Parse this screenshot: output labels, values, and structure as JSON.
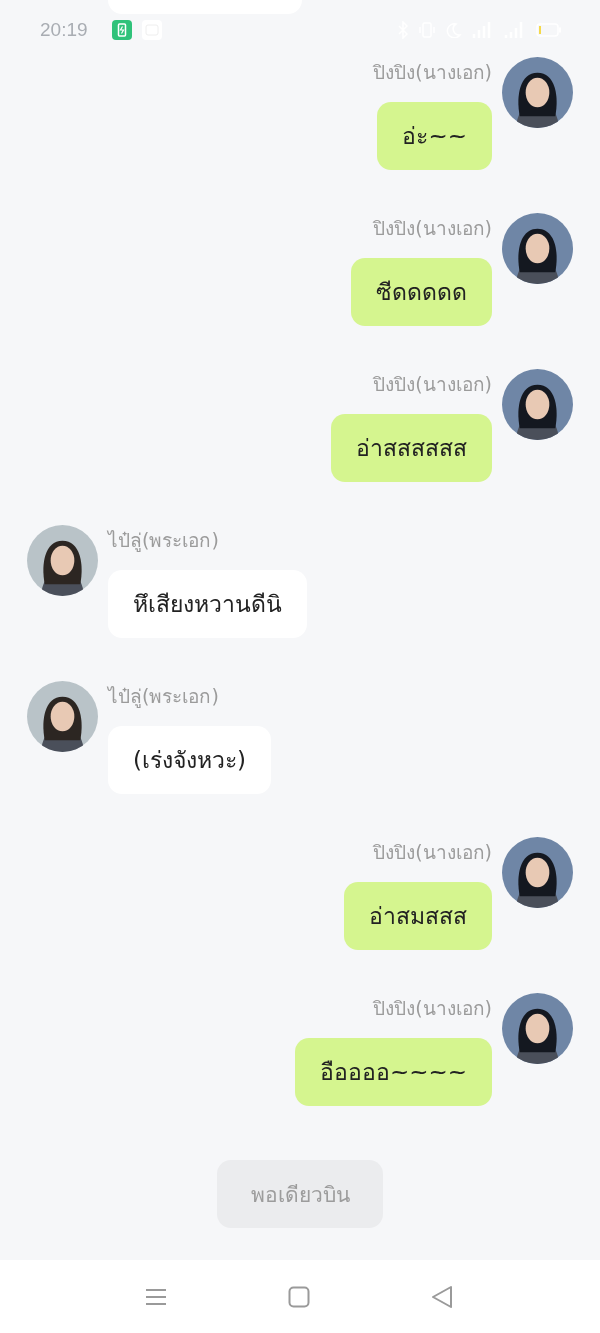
{
  "status_bar": {
    "time": "20:19"
  },
  "top_cut_bubble": {
    "kind": "received"
  },
  "messages": [
    {
      "kind": "sent",
      "sender": "ปิงปิง(นางเอก)",
      "text": "อ่ะ~~"
    },
    {
      "kind": "sent",
      "sender": "ปิงปิง(นางเอก)",
      "text": "ซีดดดดด"
    },
    {
      "kind": "sent",
      "sender": "ปิงปิง(นางเอก)",
      "text": "อ่าสสสสสส"
    },
    {
      "kind": "received",
      "sender": "ไป๋ลู่(พระเอก)",
      "text": "หึเสียงหวานดีนิ"
    },
    {
      "kind": "received",
      "sender": "ไป๋ลู่(พระเอก)",
      "text": "(เร่งจังหวะ)"
    },
    {
      "kind": "sent",
      "sender": "ปิงปิง(นางเอก)",
      "text": "อ่าสมสสส"
    },
    {
      "kind": "sent",
      "sender": "ปิงปิง(นางเอก)",
      "text": "อืออออ~~~~"
    }
  ],
  "action_button": {
    "label": "พอเดียวบิน",
    "disabled": true
  }
}
